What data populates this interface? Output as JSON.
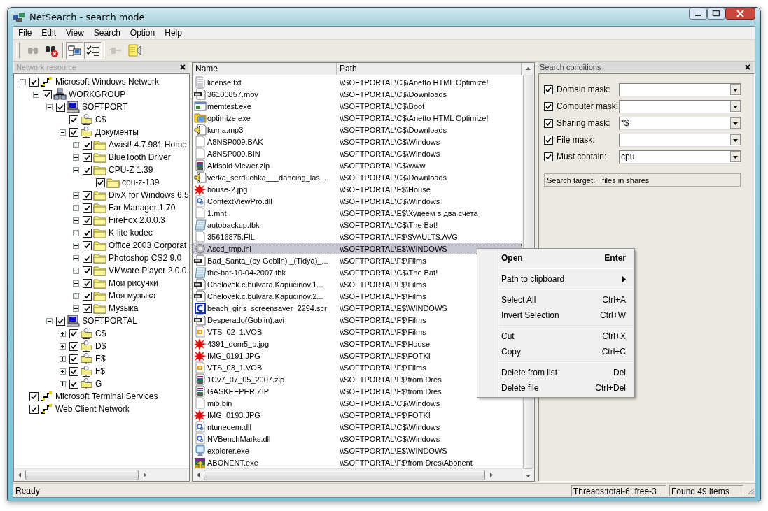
{
  "window": {
    "title": "NetSearch - search mode"
  },
  "menu": [
    {
      "label": "File"
    },
    {
      "label": "Edit"
    },
    {
      "label": "View"
    },
    {
      "label": "Search"
    },
    {
      "label": "Option"
    },
    {
      "label": "Help"
    }
  ],
  "toolbar": [
    {
      "kind": "find",
      "disabled": true,
      "pressed": false
    },
    {
      "kind": "stop",
      "disabled": false,
      "pressed": false
    },
    {
      "kind": "computers",
      "disabled": false,
      "pressed": true
    },
    {
      "kind": "checklist",
      "disabled": false,
      "pressed": true
    },
    {
      "kind": "plug",
      "disabled": true,
      "pressed": false
    },
    {
      "kind": "note",
      "disabled": false,
      "pressed": false
    }
  ],
  "network_panel": {
    "title": "Network resource",
    "tree": [
      {
        "label": "Microsoft Windows Network",
        "kind": "network",
        "checked": true,
        "expanded": true,
        "children": [
          {
            "label": "WORKGROUP",
            "kind": "workgroup",
            "checked": true,
            "expanded": true,
            "children": [
              {
                "label": "SOFTPORT",
                "kind": "computer",
                "checked": true,
                "expanded": true,
                "children": [
                  {
                    "label": "C$",
                    "kind": "share",
                    "checked": true
                  },
                  {
                    "label": "Документы",
                    "kind": "share",
                    "checked": true,
                    "expanded": true,
                    "children": [
                      {
                        "label": "Avast! 4.7.981 Home",
                        "kind": "folder",
                        "checked": true,
                        "expanded": false
                      },
                      {
                        "label": "BlueTooth Driver",
                        "kind": "folder",
                        "checked": true,
                        "expanded": false
                      },
                      {
                        "label": "CPU-Z 1.39",
                        "kind": "folder",
                        "checked": true,
                        "expanded": true,
                        "children": [
                          {
                            "label": "cpu-z-139",
                            "kind": "folder",
                            "checked": true
                          }
                        ]
                      },
                      {
                        "label": "DivX for Windows 6.5",
                        "kind": "folder",
                        "checked": true,
                        "expanded": false
                      },
                      {
                        "label": "Far Manager 1.70",
                        "kind": "folder",
                        "checked": true,
                        "expanded": false
                      },
                      {
                        "label": "FireFox 2.0.0.3",
                        "kind": "folder",
                        "checked": true,
                        "expanded": false
                      },
                      {
                        "label": "K-lite kodec",
                        "kind": "folder",
                        "checked": true,
                        "expanded": false
                      },
                      {
                        "label": "Office 2003 Corporat",
                        "kind": "folder",
                        "checked": true,
                        "expanded": false
                      },
                      {
                        "label": "Photoshop CS2 9.0",
                        "kind": "folder",
                        "checked": true,
                        "expanded": false
                      },
                      {
                        "label": "VMware Player 2.0.0.",
                        "kind": "folder",
                        "checked": true,
                        "expanded": false
                      },
                      {
                        "label": "Мои рисунки",
                        "kind": "folder",
                        "checked": true,
                        "expanded": false
                      },
                      {
                        "label": "Моя музыка",
                        "kind": "folder",
                        "checked": true,
                        "expanded": false
                      },
                      {
                        "label": "Музыка",
                        "kind": "folder",
                        "checked": true,
                        "expanded": false
                      }
                    ]
                  }
                ]
              },
              {
                "label": "SOFTPORTAL",
                "kind": "computer",
                "checked": true,
                "expanded": true,
                "children": [
                  {
                    "label": "C$",
                    "kind": "share",
                    "checked": true,
                    "expanded": false
                  },
                  {
                    "label": "D$",
                    "kind": "share",
                    "checked": true,
                    "expanded": false
                  },
                  {
                    "label": "E$",
                    "kind": "share",
                    "checked": true,
                    "expanded": false
                  },
                  {
                    "label": "F$",
                    "kind": "share",
                    "checked": true,
                    "expanded": false
                  },
                  {
                    "label": "G",
                    "kind": "share",
                    "checked": true,
                    "expanded": false
                  }
                ]
              }
            ]
          }
        ]
      },
      {
        "label": "Microsoft Terminal Services",
        "kind": "network",
        "checked": true
      },
      {
        "label": "Web Client Network",
        "kind": "network",
        "checked": true
      }
    ]
  },
  "results": {
    "columns": [
      {
        "label": "Name"
      },
      {
        "label": "Path"
      }
    ],
    "rows": [
      {
        "name": "license.txt",
        "path": "\\\\SOFTPORTAL\\C$\\Anetto HTML Optimize!",
        "kind": "text",
        "selected": false
      },
      {
        "name": "36100857.mov",
        "path": "\\\\SOFTPORTAL\\C$\\Downloads",
        "kind": "video",
        "selected": false
      },
      {
        "name": "memtest.exe",
        "path": "\\\\SOFTPORTAL\\C$\\Boot",
        "kind": "app",
        "selected": false
      },
      {
        "name": "optimize.exe",
        "path": "\\\\SOFTPORTAL\\C$\\Anetto HTML Optimize!",
        "kind": "program",
        "selected": false
      },
      {
        "name": "kuma.mp3",
        "path": "\\\\SOFTPORTAL\\C$\\Downloads",
        "kind": "audio",
        "selected": false
      },
      {
        "name": "A8NSP009.BAK",
        "path": "\\\\SOFTPORTAL\\C$\\Windows",
        "kind": "blank",
        "selected": false
      },
      {
        "name": "A8NSP009.BIN",
        "path": "\\\\SOFTPORTAL\\C$\\Windows",
        "kind": "blank",
        "selected": false
      },
      {
        "name": "Aidsoid Viewer.zip",
        "path": "\\\\SOFTPORTAL\\C$\\www",
        "kind": "archive",
        "selected": false
      },
      {
        "name": "verka_serduchka___dancing_las...",
        "path": "\\\\SOFTPORTAL\\C$\\Downloads",
        "kind": "audio",
        "selected": false
      },
      {
        "name": "house-2.jpg",
        "path": "\\\\SOFTPORTAL\\E$\\House",
        "kind": "image",
        "selected": false
      },
      {
        "name": "ContextViewPro.dll",
        "path": "\\\\SOFTPORTAL\\C$\\Windows",
        "kind": "library",
        "selected": false
      },
      {
        "name": "1.mht",
        "path": "\\\\SOFTPORTAL\\E$\\Худеем в два счета",
        "kind": "blank",
        "selected": false
      },
      {
        "name": "autobackup.tbk",
        "path": "\\\\SOFTPORTAL\\C$\\The Bat!",
        "kind": "notebook",
        "selected": false
      },
      {
        "name": "35616875.FIL",
        "path": "\\\\SOFTPORTAL\\F$\\$VAULT$.AVG",
        "kind": "blank",
        "selected": false
      },
      {
        "name": "Ascd_tmp.ini",
        "path": "\\\\SOFTPORTAL\\E$\\WINDOWS",
        "kind": "settings",
        "selected": true
      },
      {
        "name": "Bad_Santa_(by Goblin) _(Tidya)_...",
        "path": "\\\\SOFTPORTAL\\F$\\Films",
        "kind": "video",
        "selected": false
      },
      {
        "name": "the-bat-10-04-2007.tbk",
        "path": "\\\\SOFTPORTAL\\C$\\The Bat!",
        "kind": "notebook",
        "selected": false
      },
      {
        "name": "Chelovek.c.bulvara.Kapucinov.1...",
        "path": "\\\\SOFTPORTAL\\F$\\Films",
        "kind": "video",
        "selected": false
      },
      {
        "name": "Chelovek.c.bulvara.Kapucinov.2...",
        "path": "\\\\SOFTPORTAL\\F$\\Films",
        "kind": "video",
        "selected": false
      },
      {
        "name": "beach_girls_screensaver_2294.scr",
        "path": "\\\\SOFTPORTAL\\E$\\WINDOWS",
        "kind": "screensaver",
        "selected": false
      },
      {
        "name": "Desperado(Goblin).avi",
        "path": "\\\\SOFTPORTAL\\F$\\Films",
        "kind": "video",
        "selected": false
      },
      {
        "name": "VTS_02_1.VOB",
        "path": "\\\\SOFTPORTAL\\F$\\Films",
        "kind": "media",
        "selected": false
      },
      {
        "name": "4391_dom5_b.jpg",
        "path": "\\\\SOFTPORTAL\\F$\\House",
        "kind": "image",
        "selected": false
      },
      {
        "name": "IMG_0191.JPG",
        "path": "\\\\SOFTPORTAL\\F$\\FOTKI",
        "kind": "image",
        "selected": false
      },
      {
        "name": "VTS_03_1.VOB",
        "path": "\\\\SOFTPORTAL\\F$\\Films",
        "kind": "media",
        "selected": false
      },
      {
        "name": "1Cv7_07_05_2007.zip",
        "path": "\\\\SOFTPORTAL\\F$\\from Dres",
        "kind": "archive",
        "selected": false
      },
      {
        "name": "GASKEEPER.ZIP",
        "path": "\\\\SOFTPORTAL\\F$\\from Dres",
        "kind": "archive",
        "selected": false
      },
      {
        "name": "mib.bin",
        "path": "\\\\SOFTPORTAL\\C$\\Windows",
        "kind": "blank",
        "selected": false
      },
      {
        "name": "IMG_0193.JPG",
        "path": "\\\\SOFTPORTAL\\F$\\FOTKI",
        "kind": "image",
        "selected": false
      },
      {
        "name": "ntuneoem.dll",
        "path": "\\\\SOFTPORTAL\\C$\\Windows",
        "kind": "library",
        "selected": false
      },
      {
        "name": "NVBenchMarks.dll",
        "path": "\\\\SOFTPORTAL\\C$\\Windows",
        "kind": "library",
        "selected": false
      },
      {
        "name": "explorer.exe",
        "path": "\\\\SOFTPORTAL\\E$\\WINDOWS",
        "kind": "explorer",
        "selected": false
      },
      {
        "name": "ABONENT.exe",
        "path": "\\\\SOFTPORTAL\\F$\\from Dres\\Abonent",
        "kind": "installer",
        "selected": false
      }
    ]
  },
  "conditions_panel": {
    "title": "Search conditions",
    "conditions": [
      {
        "label": "Domain mask:",
        "checked": true
      },
      {
        "label": "Computer mask:",
        "checked": true
      },
      {
        "label": "Sharing mask:",
        "checked": true,
        "value": "*$"
      },
      {
        "label": "File mask:",
        "checked": true
      },
      {
        "label": "Must contain:",
        "checked": true,
        "value": "cpu"
      }
    ],
    "target_label": "Search target:",
    "target_value": "files in shares"
  },
  "context_menu": [
    [
      {
        "label": "Open",
        "shortcut": "Enter",
        "default": true
      }
    ],
    [
      {
        "label": "Path to clipboard",
        "submenu": true
      }
    ],
    [
      {
        "label": "Select All",
        "shortcut": "Ctrl+A"
      },
      {
        "label": "Invert Selection",
        "shortcut": "Ctrl+W"
      }
    ],
    [
      {
        "label": "Cut",
        "shortcut": "Ctrl+X"
      },
      {
        "label": "Copy",
        "shortcut": "Ctrl+C"
      }
    ],
    [
      {
        "label": "Delete from list",
        "shortcut": "Del"
      },
      {
        "label": "Delete file",
        "shortcut": "Ctrl+Del"
      }
    ]
  ],
  "status_bar": {
    "message": "Ready",
    "threads": "Threads:total-6; free-3",
    "found": "Found 49 items"
  }
}
